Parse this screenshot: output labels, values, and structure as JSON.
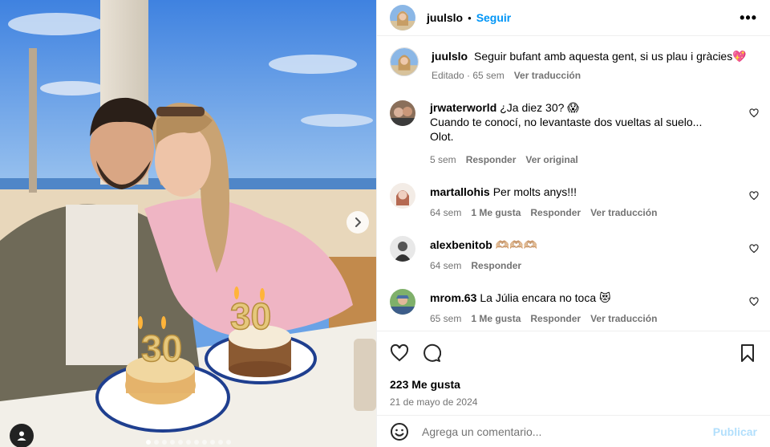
{
  "post": {
    "author": "juulslo",
    "separator": "•",
    "follow_label": "Seguir",
    "more_label": "•••"
  },
  "caption": {
    "username": "juulslo",
    "text": "Seguir bufant amb aquesta gent, si us plau i gràcies",
    "emoji": "💖",
    "meta": [
      "Editado · 65 sem",
      "Ver traducción"
    ]
  },
  "comments": [
    {
      "username": "jrwaterworld",
      "lines": [
        "¿Ja diez 30? 😱",
        "Cuando te conocí, no levantaste dos vueltas al suelo...",
        "Olot."
      ],
      "time": "5 sem",
      "likes": "",
      "reply": "Responder",
      "translate": "Ver original"
    },
    {
      "username": "martallohis",
      "lines": [
        "Per molts anys!!!"
      ],
      "time": "64 sem",
      "likes": "1 Me gusta",
      "reply": "Responder",
      "translate": "Ver traducción"
    },
    {
      "username": "alexbenitob",
      "lines": [
        "🫶🏼🫶🏼🫶🏼"
      ],
      "time": "64 sem",
      "likes": "",
      "reply": "Responder",
      "translate": ""
    },
    {
      "username": "mrom.63",
      "lines": [
        "La Júlia encara no toca 😻"
      ],
      "time": "65 sem",
      "likes": "1 Me gusta",
      "reply": "Responder",
      "translate": "Ver traducción"
    }
  ],
  "icons": {
    "like": "heart-icon",
    "comment": "comment-icon",
    "save": "bookmark-icon",
    "emoji": "emoji-icon",
    "next": "chevron-right-icon",
    "tag": "user-tag-icon"
  },
  "stats": {
    "likes": "223 Me gusta",
    "date": "21 de mayo de 2024"
  },
  "composer": {
    "placeholder": "Agrega un comentario...",
    "publish_label": "Publicar"
  },
  "carousel": {
    "count": 11,
    "active_index": 0
  },
  "photo": {
    "candle_text_1": "30",
    "candle_text_2": "30"
  },
  "colors": {
    "link_blue": "#0095f6",
    "publish_disabled": "#b2dffc",
    "meta_gray": "#737373"
  }
}
